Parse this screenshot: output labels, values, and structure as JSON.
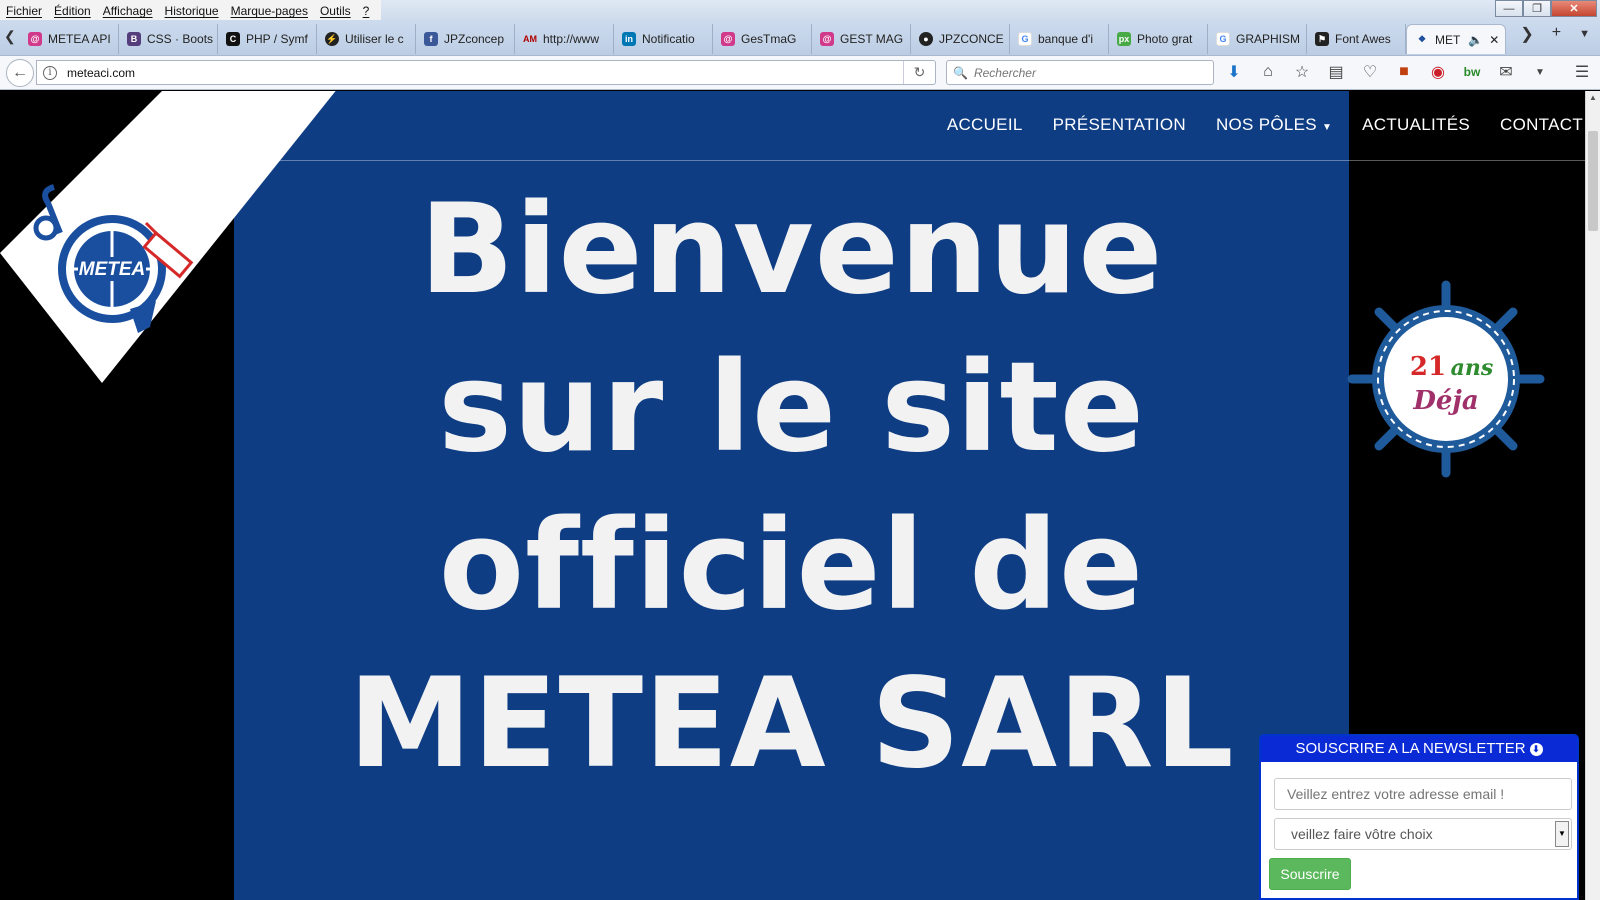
{
  "menubar": {
    "items": [
      "Fichier",
      "Édition",
      "Affichage",
      "Historique",
      "Marque-pages",
      "Outils",
      "?"
    ]
  },
  "tabs": [
    {
      "label": "METEA API",
      "icon": "app-icon",
      "color": "#d13a8a"
    },
    {
      "label": "CSS · Boots",
      "icon": "bootstrap-icon",
      "color": "#563d7c"
    },
    {
      "label": "PHP / Symf",
      "icon": "cm-icon",
      "color": "#111111"
    },
    {
      "label": "Utiliser le c",
      "icon": "bolt-icon",
      "color": "#222222"
    },
    {
      "label": "JPZconcep",
      "icon": "facebook-icon",
      "color": "#3b5998"
    },
    {
      "label": "http://www",
      "icon": "am-icon",
      "color": "#b00000"
    },
    {
      "label": "Notificatio",
      "icon": "linkedin-icon",
      "color": "#0077b5"
    },
    {
      "label": "GesTmaG",
      "icon": "app-icon",
      "color": "#d13a8a"
    },
    {
      "label": "GEST MAG",
      "icon": "app-icon",
      "color": "#d13a8a"
    },
    {
      "label": "JPZCONCE",
      "icon": "github-icon",
      "color": "#222222"
    },
    {
      "label": "banque d'i",
      "icon": "google-icon",
      "color": "#4285f4"
    },
    {
      "label": "Photo grat",
      "icon": "pixabay-icon",
      "color": "#48a947"
    },
    {
      "label": "GRAPHISM",
      "icon": "google-icon",
      "color": "#4285f4"
    },
    {
      "label": "Font Awes",
      "icon": "flag-icon",
      "color": "#222222"
    },
    {
      "label": "MET",
      "icon": "metea-icon",
      "color": "#1b4d9c",
      "active": true
    }
  ],
  "nav": {
    "url": "meteaci.com",
    "search_placeholder": "Rechercher"
  },
  "site": {
    "logo_text": "METEA",
    "menu": [
      "ACCUEIL",
      "PRÉSENTATION",
      "NOS PÔLES",
      "ACTUALITÉS",
      "CONTACT"
    ],
    "hero_lines": [
      "Bienvenue",
      "sur le site",
      "officiel de",
      "METEA SARL"
    ],
    "badge_line1_num": "21",
    "badge_line1_word": "ans",
    "badge_line2": "Déja",
    "hero_color": "#0f3d84"
  },
  "newsletter": {
    "title": "SOUSCRIRE A LA NEWSLETTER",
    "email_placeholder": "Veillez entrez votre adresse email !",
    "select_value": "veillez faire vôtre choix",
    "submit_label": "Souscrire",
    "accent": "#0a2ad6",
    "button_color": "#5cb85c"
  }
}
